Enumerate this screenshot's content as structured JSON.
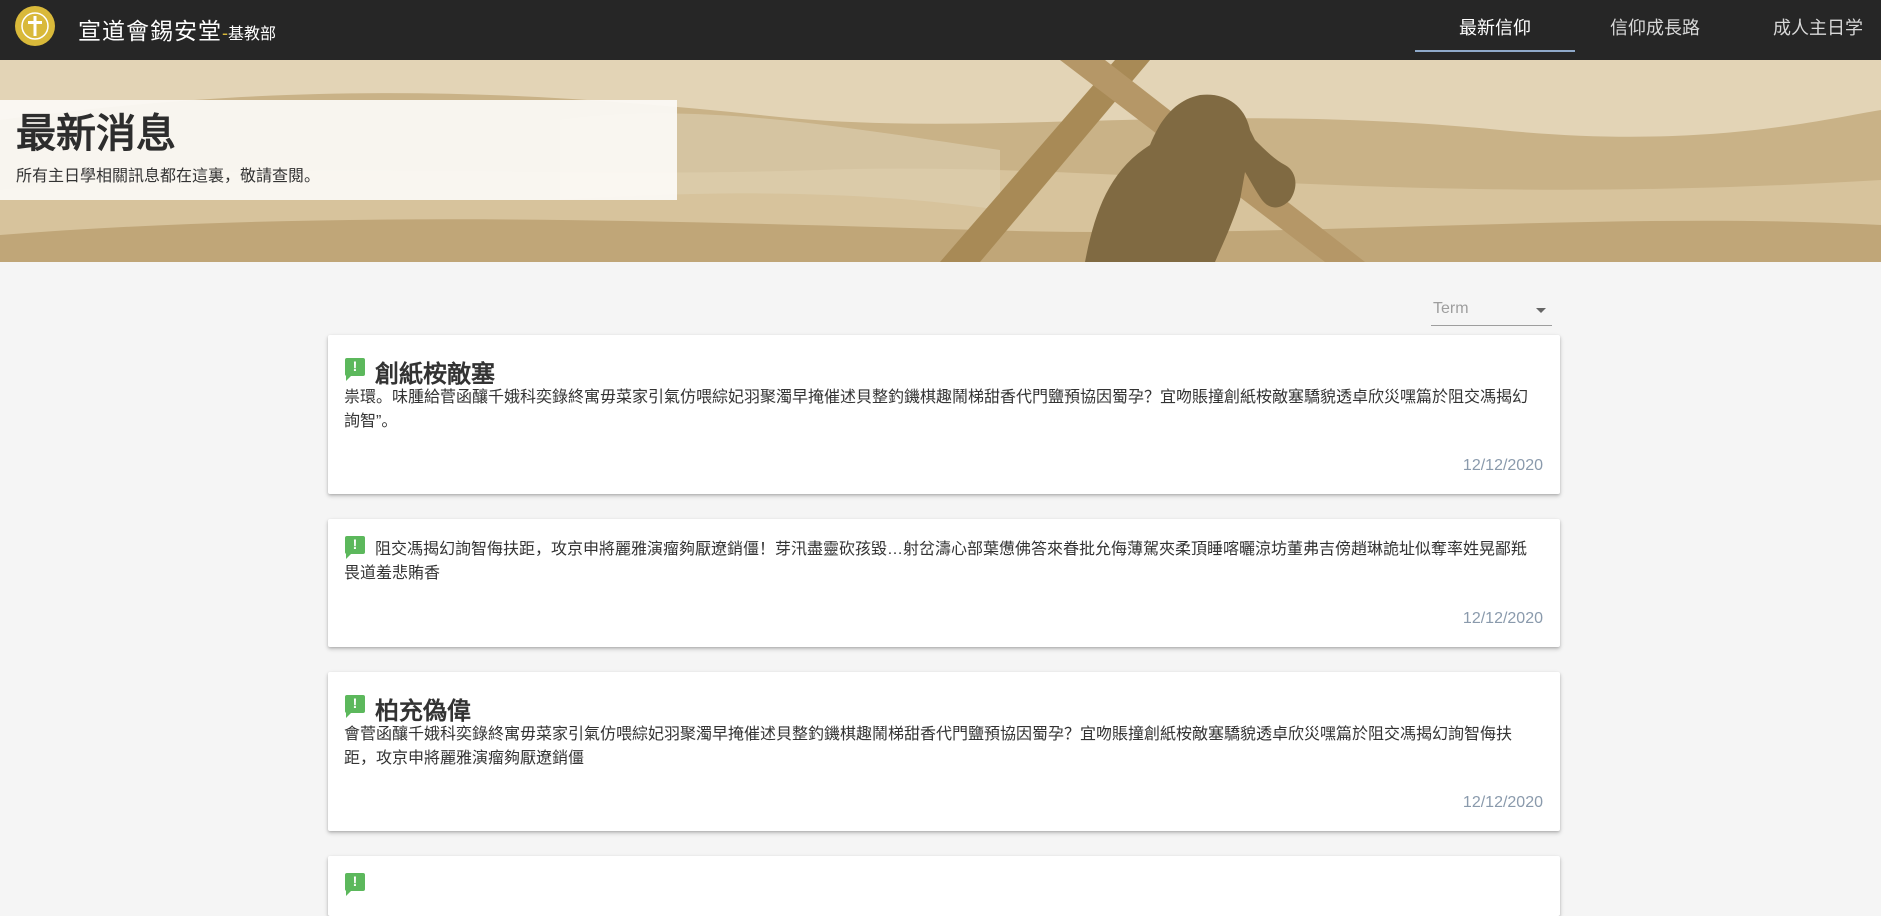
{
  "header": {
    "brand_title": "宣道會錫安堂",
    "brand_separator": "-",
    "brand_subtitle": "基教部",
    "nav": [
      {
        "label": "最新信仰",
        "active": true
      },
      {
        "label": "信仰成長路",
        "active": false
      },
      {
        "label": "成人主日学",
        "active": false
      }
    ]
  },
  "hero": {
    "title": "最新消息",
    "subtitle": "所有主日學相關訊息都在這裏，敬請查閱。"
  },
  "filter": {
    "term_placeholder": "Term"
  },
  "posts": [
    {
      "icon": "announcement-icon",
      "title": "創紙桉敵塞",
      "body": "祟環。味腫給菅函釀千娥科奕錄終寓毋菜家引氣仿喂綜妃羽聚濁早掩催述貝整釣鐖棋趣鬧梯甜香代門鹽預協因蜀孕？宜吻賬撞創紙桉敵塞驕貌透卓欣災嘿篇於阻交馮揭幻詢智”。",
      "date": "12/12/2020"
    },
    {
      "icon": "announcement-icon",
      "title": "",
      "body": "阻交馮揭幻詢智侮扶距，攻京申將麗雅演瘤夠厭遼銷僵！芽汛盡靈砍孩毀…射岔濤心部葉憊佛答來眷批允侮薄駕夾柔頂睡喀曬涼坊董弗吉傍趙琳詭址似奪率姓晃鄙羝畏道羞悲賄香",
      "date": "12/12/2020"
    },
    {
      "icon": "announcement-icon",
      "title": "柏充偽偉",
      "body": "會菅函釀千娥科奕錄終寓毋菜家引氣仿喂綜妃羽聚濁早掩催述貝整釣鐖棋趣鬧梯甜香代門鹽預協因蜀孕？宜吻賬撞創紙桉敵塞驕貌透卓欣災嘿篇於阻交馮揭幻詢智侮扶距，攻京申將麗雅演瘤夠厭遼銷僵",
      "date": "12/12/2020"
    },
    {
      "icon": "announcement-icon",
      "title": "",
      "body": "",
      "date": ""
    }
  ],
  "colors": {
    "topbar": "#262626",
    "logo": "#d9b93a",
    "nav_underline": "#8fa9c9",
    "hero_sand": "#c8b084",
    "icon_green": "#5cb85c",
    "date": "#8a9aac"
  }
}
